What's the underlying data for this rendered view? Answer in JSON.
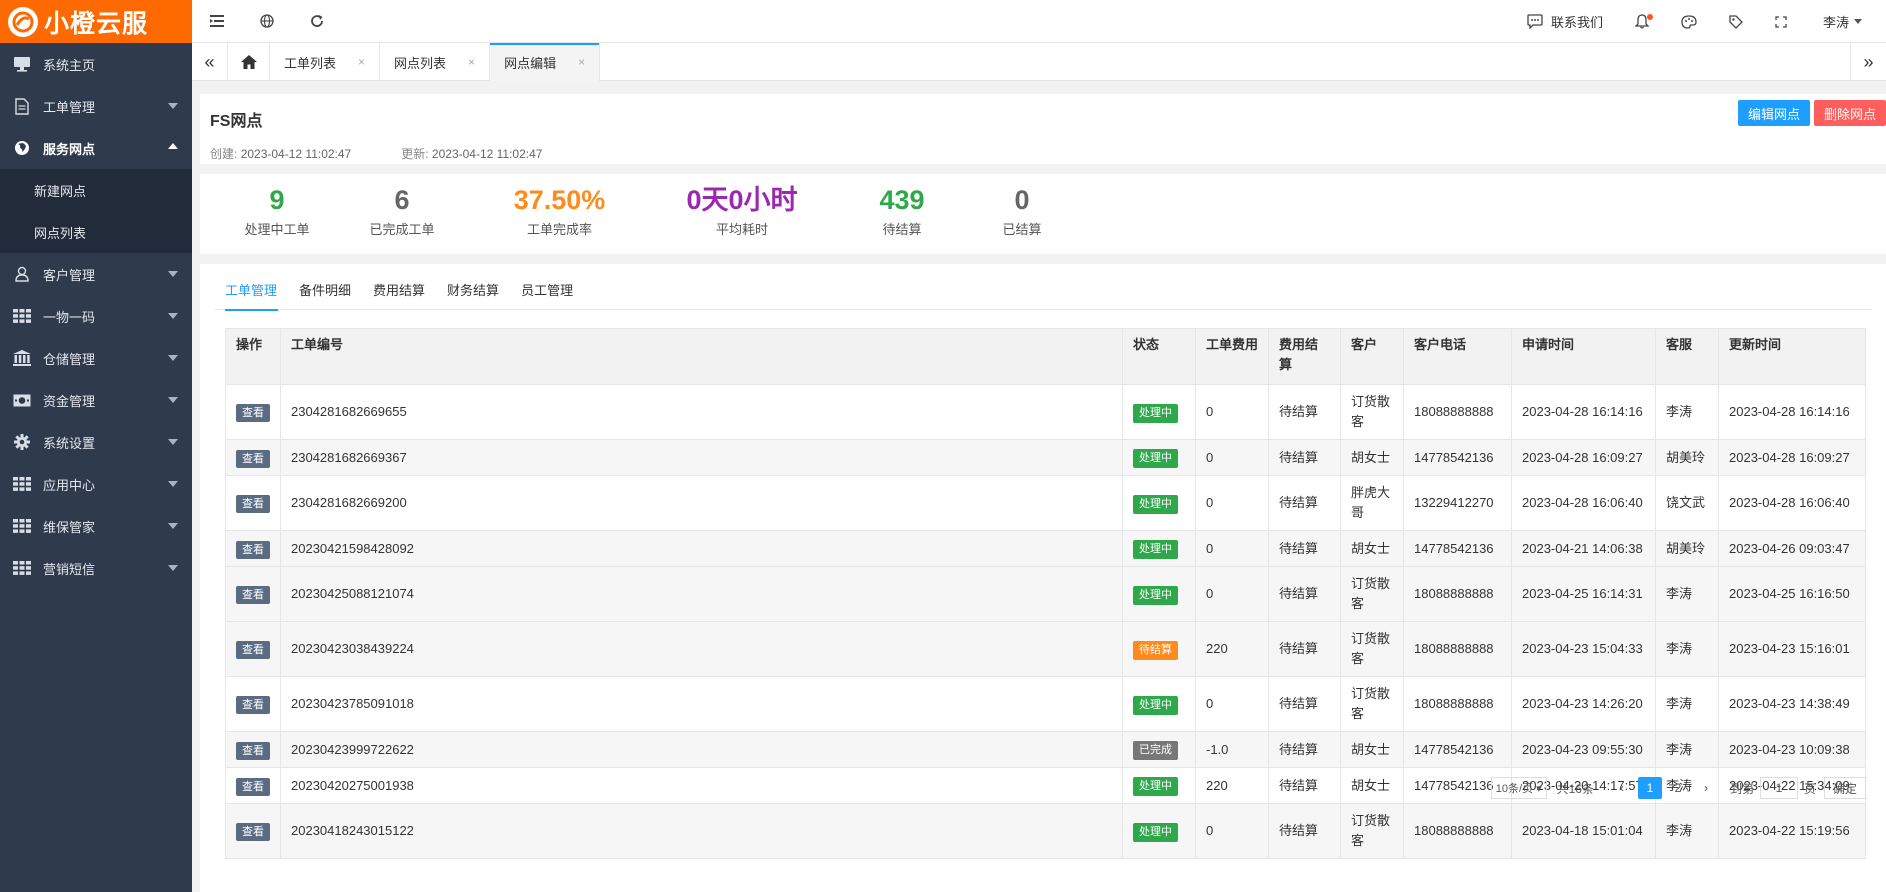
{
  "brand": {
    "name": "小橙云服"
  },
  "sidebar": {
    "items": [
      {
        "label": "系统主页",
        "icon": "monitor-icon"
      },
      {
        "label": "工单管理",
        "icon": "document-icon"
      },
      {
        "label": "服务网点",
        "icon": "globe-icon",
        "open": true,
        "children": [
          {
            "label": "新建网点"
          },
          {
            "label": "网点列表"
          }
        ]
      },
      {
        "label": "客户管理",
        "icon": "user-icon"
      },
      {
        "label": "一物一码",
        "icon": "grid-icon"
      },
      {
        "label": "仓储管理",
        "icon": "bank-icon"
      },
      {
        "label": "资金管理",
        "icon": "money-icon"
      },
      {
        "label": "系统设置",
        "icon": "gear-icon"
      },
      {
        "label": "应用中心",
        "icon": "grid-icon"
      },
      {
        "label": "维保管家",
        "icon": "grid-icon"
      },
      {
        "label": "营销短信",
        "icon": "grid-icon"
      }
    ]
  },
  "topbar": {
    "contact": "联系我们",
    "user": "李涛"
  },
  "tabs": [
    {
      "label": "工单列表"
    },
    {
      "label": "网点列表"
    },
    {
      "label": "网点编辑",
      "active": true
    }
  ],
  "header": {
    "title": "FS网点",
    "created_label": "创建:",
    "created": "2023-04-12 11:02:47",
    "updated_label": "更新:",
    "updated": "2023-04-12 11:02:47",
    "edit_button": "编辑网点",
    "delete_button": "删除网点"
  },
  "stats": [
    {
      "value": "9",
      "label": "处理中工单",
      "color": "#2ea84a"
    },
    {
      "value": "6",
      "label": "已完成工单",
      "color": "#666666"
    },
    {
      "value": "37.50%",
      "label": "工单完成率",
      "color": "#ff8b1e"
    },
    {
      "value": "0天0小时",
      "label": "平均耗时",
      "color": "#9c27b0"
    },
    {
      "value": "439",
      "label": "待结算",
      "color": "#2ea84a"
    },
    {
      "value": "0",
      "label": "已结算",
      "color": "#666666"
    }
  ],
  "subtabs": [
    "工单管理",
    "备件明细",
    "费用结算",
    "财务结算",
    "员工管理"
  ],
  "table": {
    "headers": [
      "操作",
      "工单编号",
      "状态",
      "工单费用",
      "费用结算",
      "客户",
      "客户电话",
      "申请时间",
      "客服",
      "更新时间"
    ],
    "view_label": "查看",
    "rows": [
      {
        "id": "2304281682669655",
        "status": "处理中",
        "status_color": "green",
        "fee": "0",
        "settle": "待结算",
        "customer": "订货散客",
        "phone": "18088888888",
        "applied": "2023-04-28 16:14:16",
        "agent": "李涛",
        "updated": "2023-04-28 16:14:16"
      },
      {
        "id": "2304281682669367",
        "status": "处理中",
        "status_color": "green",
        "fee": "0",
        "settle": "待结算",
        "customer": "胡女士",
        "phone": "14778542136",
        "applied": "2023-04-28 16:09:27",
        "agent": "胡美玲",
        "updated": "2023-04-28 16:09:27"
      },
      {
        "id": "2304281682669200",
        "status": "处理中",
        "status_color": "green",
        "fee": "0",
        "settle": "待结算",
        "customer": "胖虎大哥",
        "phone": "13229412270",
        "applied": "2023-04-28 16:06:40",
        "agent": "饶文武",
        "updated": "2023-04-28 16:06:40"
      },
      {
        "id": "20230421598428092",
        "status": "处理中",
        "status_color": "green",
        "fee": "0",
        "settle": "待结算",
        "customer": "胡女士",
        "phone": "14778542136",
        "applied": "2023-04-21 14:06:38",
        "agent": "胡美玲",
        "updated": "2023-04-26 09:03:47"
      },
      {
        "id": "20230425088121074",
        "status": "处理中",
        "status_color": "green",
        "fee": "0",
        "settle": "待结算",
        "customer": "订货散客",
        "phone": "18088888888",
        "applied": "2023-04-25 16:14:31",
        "agent": "李涛",
        "updated": "2023-04-25 16:16:50"
      },
      {
        "id": "20230423038439224",
        "status": "待结算",
        "status_color": "orange",
        "fee": "220",
        "settle": "待结算",
        "customer": "订货散客",
        "phone": "18088888888",
        "applied": "2023-04-23 15:04:33",
        "agent": "李涛",
        "updated": "2023-04-23 15:16:01"
      },
      {
        "id": "20230423785091018",
        "status": "处理中",
        "status_color": "green",
        "fee": "0",
        "settle": "待结算",
        "customer": "订货散客",
        "phone": "18088888888",
        "applied": "2023-04-23 14:26:20",
        "agent": "李涛",
        "updated": "2023-04-23 14:38:49"
      },
      {
        "id": "20230423999722622",
        "status": "已完成",
        "status_color": "gray",
        "fee": "-1.0",
        "settle": "待结算",
        "customer": "胡女士",
        "phone": "14778542136",
        "applied": "2023-04-23 09:55:30",
        "agent": "李涛",
        "updated": "2023-04-23 10:09:38"
      },
      {
        "id": "20230420275001938",
        "status": "处理中",
        "status_color": "green",
        "fee": "220",
        "settle": "待结算",
        "customer": "胡女士",
        "phone": "14778542136",
        "applied": "2023-04-20 14:17:57",
        "agent": "李涛",
        "updated": "2023-04-22 15:34:09"
      },
      {
        "id": "20230418243015122",
        "status": "处理中",
        "status_color": "green",
        "fee": "0",
        "settle": "待结算",
        "customer": "订货散客",
        "phone": "18088888888",
        "applied": "2023-04-18 15:01:04",
        "agent": "李涛",
        "updated": "2023-04-22 15:19:56"
      }
    ]
  },
  "pagination": {
    "page_size": "10条/页",
    "total": "共16条",
    "pages": [
      "1",
      "2"
    ],
    "current": "1",
    "goto_label": "到第",
    "goto_value": "1",
    "page_suffix": "页",
    "confirm": "确定"
  }
}
